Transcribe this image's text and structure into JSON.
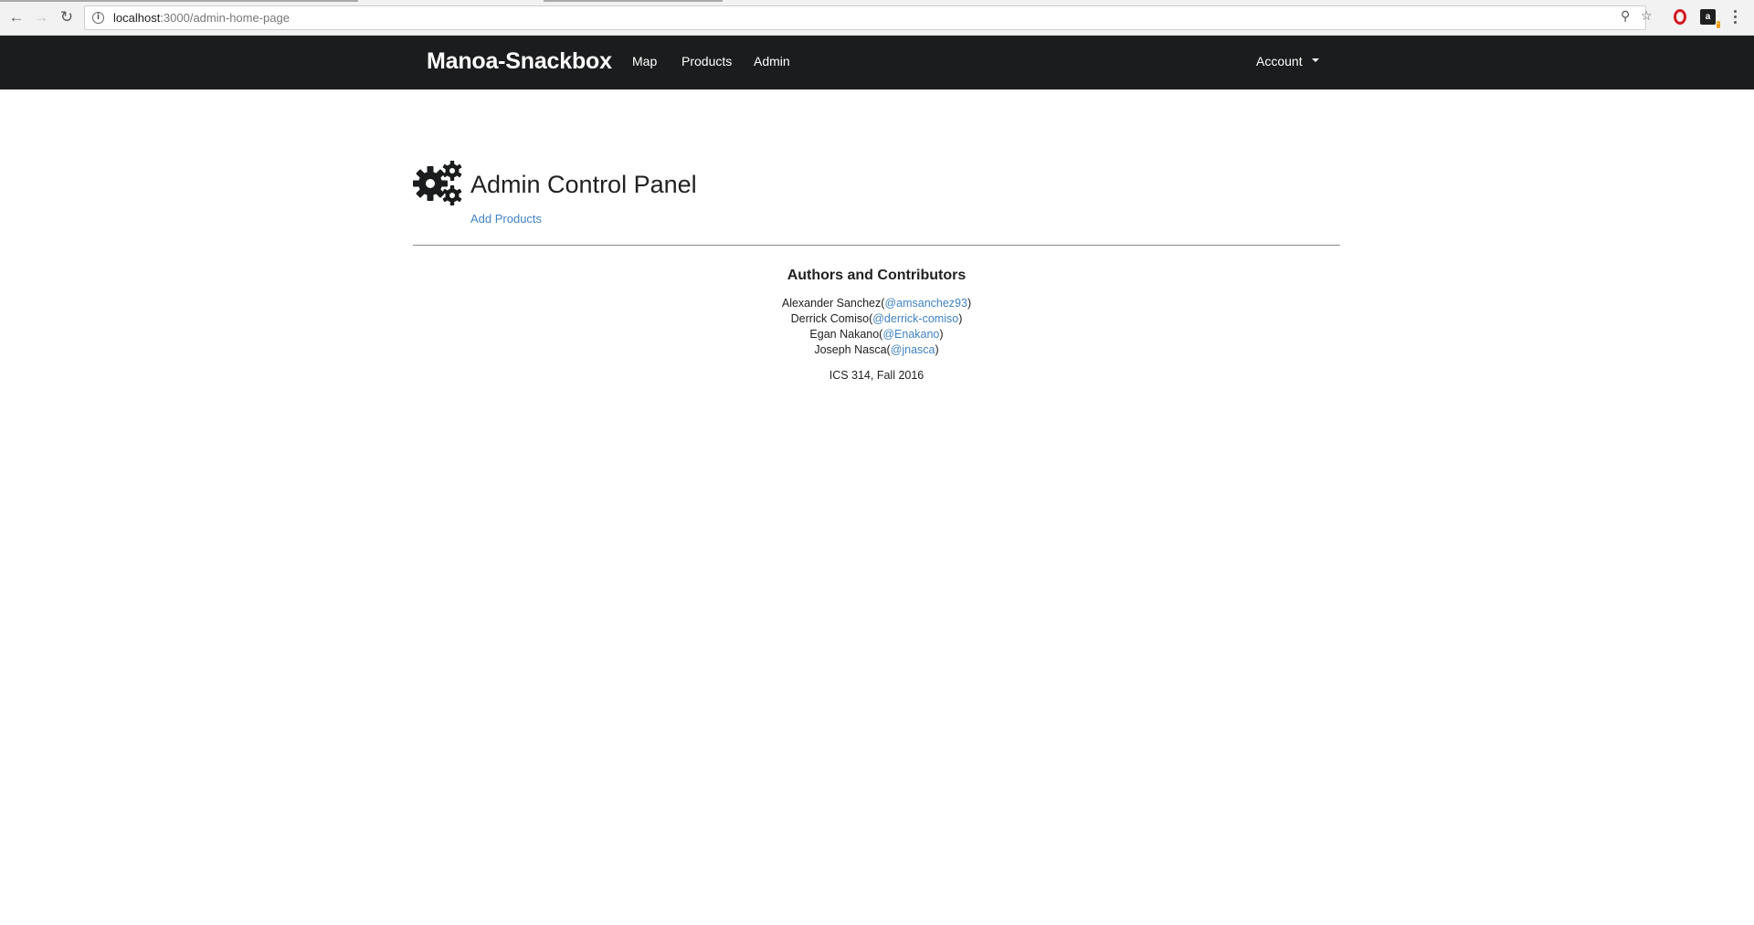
{
  "browser": {
    "url_host": "localhost",
    "url_path": ":3000/admin-home-page"
  },
  "navbar": {
    "brand": "Manoa-Snackbox",
    "items": [
      {
        "label": "Map"
      },
      {
        "label": "Products"
      },
      {
        "label": "Admin"
      }
    ],
    "account_label": "Account"
  },
  "main": {
    "title": "Admin Control Panel",
    "title_icon": "gears-icon",
    "link_label": "Add Products"
  },
  "footer": {
    "heading": "Authors and Contributors",
    "authors": [
      {
        "name": "Alexander Sanchez(",
        "handle": "@amsanchez93",
        "close": ")"
      },
      {
        "name": "Derrick Comiso(",
        "handle": "@derrick-comiso",
        "close": ")"
      },
      {
        "name": "Egan Nakano(",
        "handle": "@Enakano",
        "close": ")"
      },
      {
        "name": "Joseph Nasca(",
        "handle": "@jnasca",
        "close": ")"
      }
    ],
    "course": "ICS 314, Fall 2016"
  },
  "colors": {
    "navbar_bg": "#1b1c1d",
    "link": "#4183c4",
    "text": "#212121"
  }
}
